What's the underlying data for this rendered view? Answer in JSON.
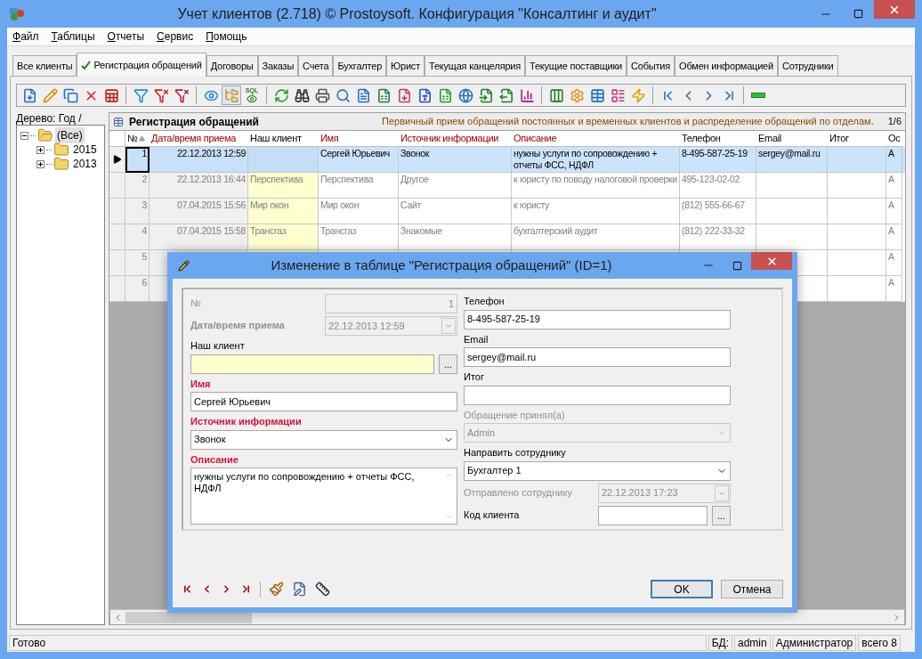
{
  "window": {
    "title": "Учет клиентов (2.718) © Prostoysoft. Конфигурация \"Консалтинг и аудит\""
  },
  "menu": [
    {
      "label": "Файл"
    },
    {
      "label": "Таблицы"
    },
    {
      "label": "Отчеты"
    },
    {
      "label": "Сервис"
    },
    {
      "label": "Помощь"
    }
  ],
  "tabs": [
    {
      "label": "Все клиенты",
      "selected": false
    },
    {
      "label": "Регистрация обращений",
      "selected": true
    },
    {
      "label": "Договоры",
      "selected": false
    },
    {
      "label": "Заказы",
      "selected": false
    },
    {
      "label": "Счета",
      "selected": false
    },
    {
      "label": "Бухгалтер",
      "selected": false
    },
    {
      "label": "Юрист",
      "selected": false
    },
    {
      "label": "Текущая канцелярия",
      "selected": false
    },
    {
      "label": "Текущие поставщики",
      "selected": false
    },
    {
      "label": "События",
      "selected": false
    },
    {
      "label": "Обмен информацией",
      "selected": false
    },
    {
      "label": "Сотрудники",
      "selected": false
    }
  ],
  "toolbar": [
    {
      "kind": "button",
      "pressed": false
    },
    {
      "kind": "button",
      "pressed": false
    },
    {
      "kind": "button",
      "pressed": false
    },
    {
      "kind": "button",
      "pressed": false
    },
    {
      "kind": "button",
      "pressed": false
    },
    {
      "kind": "separator"
    },
    {
      "kind": "button",
      "pressed": false
    },
    {
      "kind": "button",
      "pressed": false
    },
    {
      "kind": "button",
      "pressed": false
    },
    {
      "kind": "separator"
    },
    {
      "kind": "button",
      "pressed": false
    },
    {
      "kind": "button",
      "pressed": true
    },
    {
      "kind": "button",
      "pressed": false,
      "text": "SQL"
    },
    {
      "kind": "separator"
    },
    {
      "kind": "button",
      "pressed": false
    },
    {
      "kind": "button",
      "pressed": false
    },
    {
      "kind": "button",
      "pressed": false
    },
    {
      "kind": "button",
      "pressed": false
    },
    {
      "kind": "button",
      "pressed": false
    },
    {
      "kind": "button",
      "pressed": false
    },
    {
      "kind": "button",
      "pressed": false
    },
    {
      "kind": "button",
      "pressed": false
    },
    {
      "kind": "button",
      "pressed": false
    },
    {
      "kind": "button",
      "pressed": false
    },
    {
      "kind": "button",
      "pressed": false
    },
    {
      "kind": "button",
      "pressed": false
    },
    {
      "kind": "button",
      "pressed": false
    },
    {
      "kind": "separator"
    },
    {
      "kind": "button",
      "pressed": false
    },
    {
      "kind": "button",
      "pressed": false
    },
    {
      "kind": "button",
      "pressed": false
    },
    {
      "kind": "button",
      "pressed": false
    },
    {
      "kind": "button",
      "pressed": false
    },
    {
      "kind": "separator"
    },
    {
      "kind": "button",
      "pressed": false
    },
    {
      "kind": "button",
      "pressed": false
    },
    {
      "kind": "button",
      "pressed": false
    },
    {
      "kind": "button",
      "pressed": false
    },
    {
      "kind": "separator"
    },
    {
      "kind": "button",
      "pressed": false
    }
  ],
  "tree": {
    "caption": "Дерево: Год /",
    "items": [
      {
        "label": "(Все)",
        "expanded": true,
        "selected": true,
        "children": [
          {
            "label": "2015",
            "expanded": false,
            "selected": false
          },
          {
            "label": "2013",
            "expanded": false,
            "selected": false
          }
        ]
      }
    ]
  },
  "grid": {
    "title": "Регистрация обращений",
    "description": "Первичный прием обращений постоянных и временных клиентов и распределение обращений по отделам.",
    "position": "1/6",
    "columns": [
      {
        "label": "№",
        "required": false,
        "sorted": true,
        "readonly": true,
        "highlighted": false
      },
      {
        "label": "Дата/время приема",
        "required": true,
        "sorted": false,
        "readonly": true,
        "highlighted": false
      },
      {
        "label": "Наш клиент",
        "required": false,
        "sorted": false,
        "readonly": false,
        "highlighted": true
      },
      {
        "label": "Имя",
        "required": true,
        "sorted": false,
        "readonly": false,
        "highlighted": false
      },
      {
        "label": "Источник информации",
        "required": true,
        "sorted": false,
        "readonly": false,
        "highlighted": false
      },
      {
        "label": "Описание",
        "required": true,
        "sorted": false,
        "readonly": false,
        "highlighted": false
      },
      {
        "label": "Телефон",
        "required": false,
        "sorted": false,
        "readonly": false,
        "highlighted": false
      },
      {
        "label": "Email",
        "required": false,
        "sorted": false,
        "readonly": false,
        "highlighted": false
      },
      {
        "label": "Итог",
        "required": false,
        "sorted": false,
        "readonly": false,
        "highlighted": false
      },
      {
        "label": "Ос",
        "required": false,
        "sorted": false,
        "readonly": false,
        "highlighted": false
      }
    ],
    "rows": [
      {
        "selected": true,
        "cells": [
          "1",
          "22.12.2013 12:59",
          null,
          "Сергей Юрьевич",
          "Звонок",
          "нужны услуги по сопровождению + отчеты ФСС, НДФЛ",
          "8-495-587-25-19",
          "sergey@mail.ru",
          null,
          "А"
        ]
      },
      {
        "selected": false,
        "cells": [
          "2",
          "22.12.2013 16:44",
          "Перспектива",
          "Перспектива",
          "Другое",
          "к юристу по поводу налоговой проверки",
          "495-123-02-02",
          null,
          null,
          "А"
        ]
      },
      {
        "selected": false,
        "cells": [
          "3",
          "07.04.2015 15:56",
          "Мир окон",
          "Мир окон",
          "Сайт",
          "к юристу",
          "(812) 555-66-67",
          null,
          null,
          "А"
        ]
      },
      {
        "selected": false,
        "cells": [
          "4",
          "07.04.2015 15:58",
          "Трансгаз",
          "Трансгаз",
          "Знакомые",
          "бухгалтерский аудит",
          "(812) 222-33-32",
          null,
          null,
          "А"
        ]
      },
      {
        "selected": false,
        "cells": [
          "5",
          null,
          null,
          null,
          null,
          null,
          null,
          null,
          null,
          "А"
        ]
      },
      {
        "selected": false,
        "cells": [
          "6",
          null,
          null,
          null,
          null,
          null,
          null,
          null,
          null,
          "А"
        ]
      }
    ]
  },
  "dialog": {
    "title": "Изменение в таблице \"Регистрация обращений\" (ID=1)",
    "left_fields": [
      {
        "kind": "text",
        "label": "№",
        "value": "1",
        "inline": true,
        "required": false,
        "disabled": true
      },
      {
        "kind": "date",
        "label": "Дата/время приема",
        "value": "22.12.2013 12:59",
        "inline": true,
        "required": true,
        "disabled": true
      },
      {
        "kind": "lookup",
        "label": "Наш клиент",
        "button_label": "...",
        "inline": false,
        "required": false,
        "disabled": false,
        "highlighted": true
      },
      {
        "kind": "text",
        "label": "Имя",
        "value": "Сергей Юрьевич",
        "inline": false,
        "required": true,
        "disabled": false
      },
      {
        "kind": "select",
        "label": "Источник информации",
        "value": "Звонок",
        "inline": false,
        "required": true,
        "disabled": false
      },
      {
        "kind": "memo",
        "label": "Описание",
        "value": "нужны услуги по сопровождению + отчеты ФСС, НДФЛ",
        "inline": false,
        "required": true,
        "disabled": false
      }
    ],
    "right_fields": [
      {
        "kind": "text",
        "label": "Телефон",
        "value": "8-495-587-25-19",
        "inline": false,
        "required": false,
        "disabled": false
      },
      {
        "kind": "text",
        "label": "Email",
        "value": "sergey@mail.ru",
        "inline": false,
        "required": false,
        "disabled": false
      },
      {
        "kind": "text",
        "label": "Итог",
        "inline": false,
        "required": false,
        "disabled": false
      },
      {
        "kind": "select",
        "label": "Обращение принял(а)",
        "value": "Admin",
        "inline": false,
        "required": false,
        "disabled": true
      },
      {
        "kind": "select",
        "label": "Направить сотруднику",
        "value": "Бухгалтер 1",
        "inline": false,
        "required": false,
        "disabled": false
      },
      {
        "kind": "date",
        "label": "Отправлено сотруднику",
        "value": "22.12.2013 17:23",
        "inline": true,
        "required": false,
        "disabled": true
      },
      {
        "kind": "lookup",
        "label": "Код клиента",
        "button_label": "...",
        "inline": true,
        "required": false,
        "disabled": false,
        "highlighted": false
      }
    ],
    "buttons": [
      {
        "label": "OK",
        "default": true
      },
      {
        "label": "Отмена",
        "default": false
      }
    ]
  },
  "status_bar": {
    "message": "Готово",
    "panels": [
      "БД:",
      "admin",
      "Администратор",
      "всего 8"
    ]
  }
}
